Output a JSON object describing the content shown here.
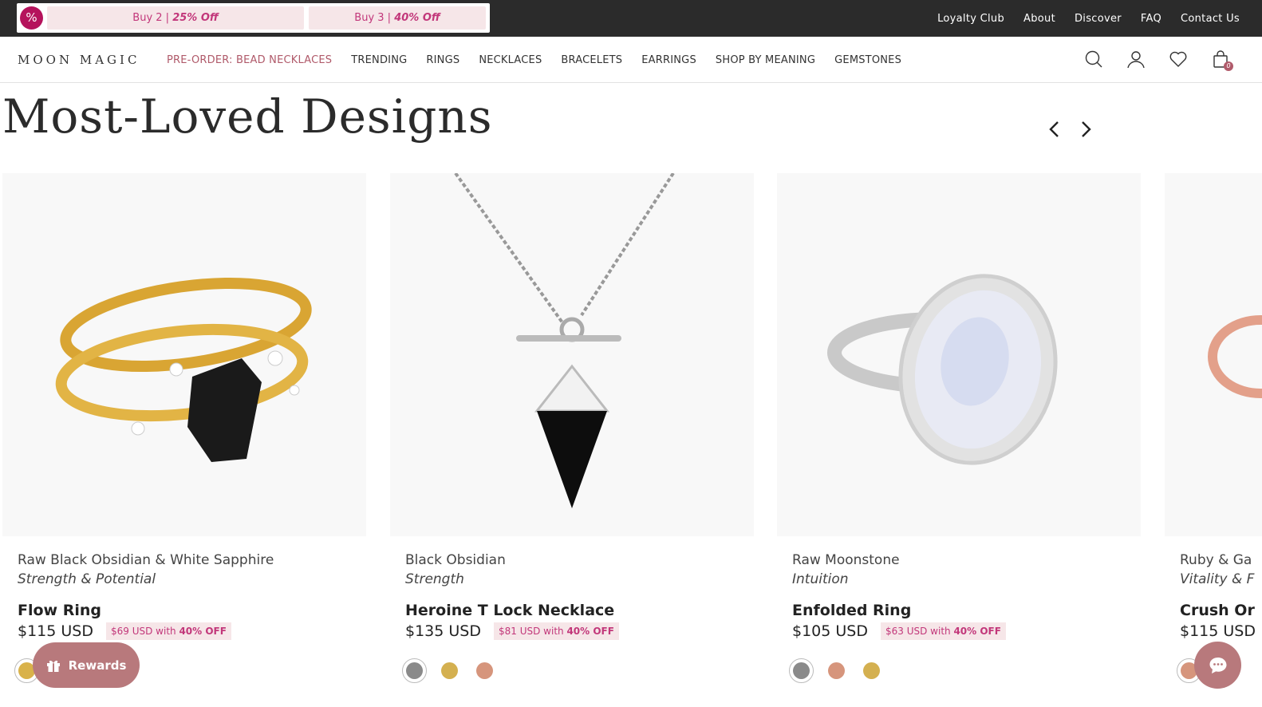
{
  "promo": {
    "icon": "%",
    "offers": [
      {
        "text": "Buy 2 | ",
        "bold": "25% Off"
      },
      {
        "text": "Buy 3 | ",
        "bold": "40% Off"
      }
    ]
  },
  "top_links": [
    "Loyalty Club",
    "About",
    "Discover",
    "FAQ",
    "Contact Us"
  ],
  "brand": "MOON MAGIC",
  "nav": [
    "PRE-ORDER: BEAD NECKLACES",
    "TRENDING",
    "RINGS",
    "NECKLACES",
    "BRACELETS",
    "EARRINGS",
    "SHOP BY MEANING",
    "GEMSTONES"
  ],
  "cart_count": "0",
  "section_title": "Most-Loved Designs",
  "products": [
    {
      "gem": "Raw Black Obsidian & White Sapphire",
      "meaning": "Strength & Potential",
      "name": "Flow Ring",
      "price": "$115 USD",
      "deal": "$69 USD with ",
      "deal_bold": "40% OFF"
    },
    {
      "gem": "Black Obsidian",
      "meaning": "Strength",
      "name": "Heroine T Lock Necklace",
      "price": "$135 USD",
      "deal": "$81 USD with ",
      "deal_bold": "40% OFF"
    },
    {
      "gem": "Raw Moonstone",
      "meaning": "Intuition",
      "name": "Enfolded Ring",
      "price": "$105 USD",
      "deal": "$63 USD with ",
      "deal_bold": "40% OFF"
    },
    {
      "gem": "Ruby & Ga",
      "meaning": "Vitality & F",
      "name": "Crush Or",
      "price": "$115 USD"
    }
  ],
  "rewards_label": "Rewards",
  "colors": {
    "topbar": "#2b2b2b",
    "accent": "#b5135c",
    "deal_text": "#c2377a",
    "deal_bg": "#f6e6e8",
    "nav_highlight": "#b05a6a",
    "floating": "#b8797c"
  }
}
